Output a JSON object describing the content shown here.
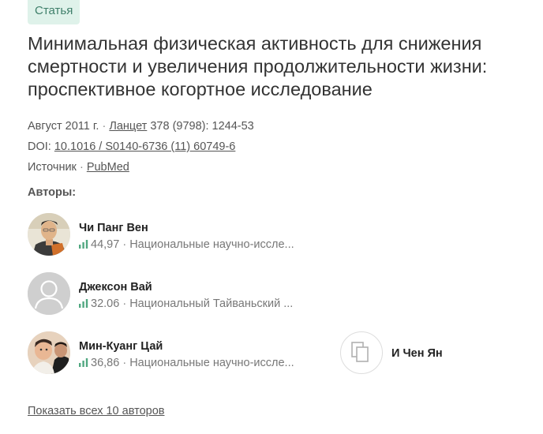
{
  "article": {
    "type_badge": "Статья",
    "title": "Минимальная физическая активность для снижения смертности и увеличения продолжительности жизни: проспективное когортное исследование",
    "date": "Август 2011 г.",
    "journal": "Ланцет",
    "citation": "378 (9798): 1244-53",
    "doi_label": "DOI:",
    "doi": "10.1016 / S0140-6736 (11) 60749-6",
    "source_label": "Источник",
    "source": "PubMed"
  },
  "authors_section": {
    "heading": "Авторы:",
    "authors": [
      {
        "name": "Чи Панг Вен",
        "score": "44,97",
        "affiliation": "Национальные научно-иссле..."
      },
      {
        "name": "Джексон Вай",
        "score": "32.06",
        "affiliation": "Национальный Тайваньский ..."
      },
      {
        "name": "Мин-Куанг Цай",
        "score": "36,86",
        "affiliation": "Национальные научно-иссле..."
      },
      {
        "name": "И Чен Ян"
      }
    ],
    "show_all": "Показать всех 10 авторов"
  },
  "icons": {
    "score": "bar-chart-icon",
    "placeholder_avatar": "person-silhouette-icon",
    "unclaimed_author": "copy-document-icon"
  },
  "colors": {
    "badge_bg": "#dff2ea",
    "badge_text": "#3f7f6a",
    "score_bars": "#51a881"
  }
}
